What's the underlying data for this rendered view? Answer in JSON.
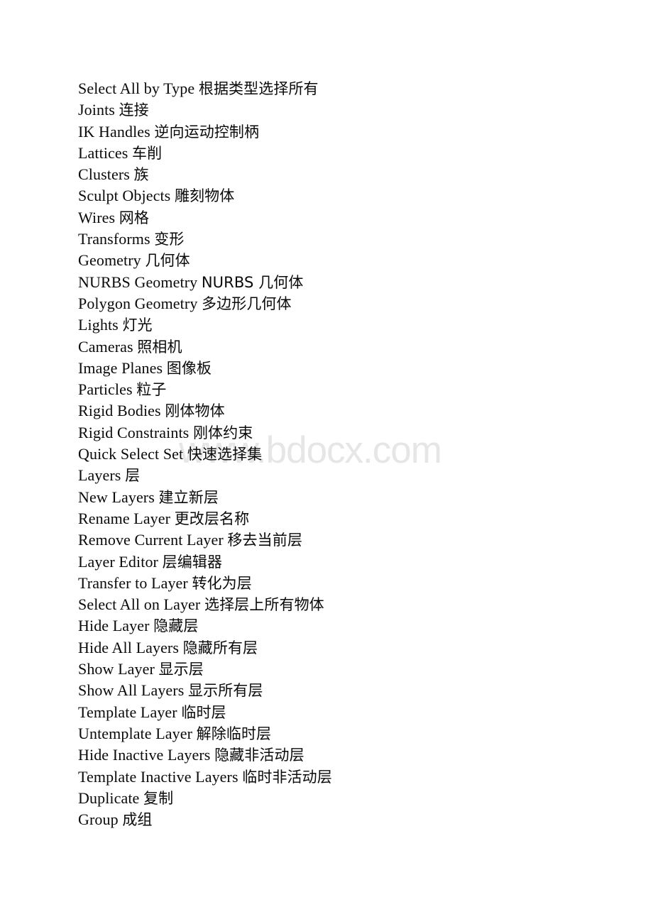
{
  "document": {
    "type": "bilingual-glossary",
    "watermark": "www.bdocx.com",
    "text_color": "#0a0a0a",
    "watermark_color": "#e6e6e6",
    "background_color": "#ffffff",
    "lines": [
      {
        "en": "Select All by Type",
        "cn": "根据类型选择所有"
      },
      {
        "en": "Joints",
        "cn": "连接"
      },
      {
        "en": "IK Handles",
        "cn": "逆向运动控制柄"
      },
      {
        "en": "Lattices",
        "cn": "车削"
      },
      {
        "en": "Clusters",
        "cn": "族"
      },
      {
        "en": "Sculpt Objects",
        "cn": "雕刻物体"
      },
      {
        "en": "Wires",
        "cn": "网格"
      },
      {
        "en": "Transforms",
        "cn": "变形"
      },
      {
        "en": "Geometry",
        "cn": "几何体"
      },
      {
        "en": "NURBS Geometry",
        "cn": "NURBS 几何体"
      },
      {
        "en": "Polygon Geometry",
        "cn": "多边形几何体"
      },
      {
        "en": "Lights",
        "cn": "灯光"
      },
      {
        "en": "Cameras",
        "cn": "照相机"
      },
      {
        "en": "Image Planes",
        "cn": "图像板"
      },
      {
        "en": "Particles",
        "cn": "粒子"
      },
      {
        "en": "Rigid Bodies",
        "cn": "刚体物体"
      },
      {
        "en": "Rigid Constraints",
        "cn": "刚体约束"
      },
      {
        "en": "Quick Select Set",
        "cn": "快速选择集"
      },
      {
        "en": "Layers",
        "cn": "层"
      },
      {
        "en": "New Layers",
        "cn": "建立新层"
      },
      {
        "en": "Rename Layer",
        "cn": "更改层名称"
      },
      {
        "en": "Remove Current Layer",
        "cn": "移去当前层"
      },
      {
        "en": "Layer Editor",
        "cn": "层编辑器"
      },
      {
        "en": "Transfer to Layer",
        "cn": "转化为层"
      },
      {
        "en": "Select All on Layer",
        "cn": "选择层上所有物体"
      },
      {
        "en": "Hide Layer",
        "cn": "隐藏层"
      },
      {
        "en": "Hide All Layers",
        "cn": "隐藏所有层"
      },
      {
        "en": "Show Layer",
        "cn": "显示层"
      },
      {
        "en": "Show All Layers",
        "cn": "显示所有层"
      },
      {
        "en": "Template Layer",
        "cn": "临时层"
      },
      {
        "en": "Untemplate Layer",
        "cn": "解除临时层"
      },
      {
        "en": "Hide Inactive Layers",
        "cn": "隐藏非活动层"
      },
      {
        "en": "Template Inactive Layers",
        "cn": "临时非活动层"
      },
      {
        "en": "Duplicate",
        "cn": "复制"
      },
      {
        "en": "Group",
        "cn": "成组"
      }
    ]
  }
}
